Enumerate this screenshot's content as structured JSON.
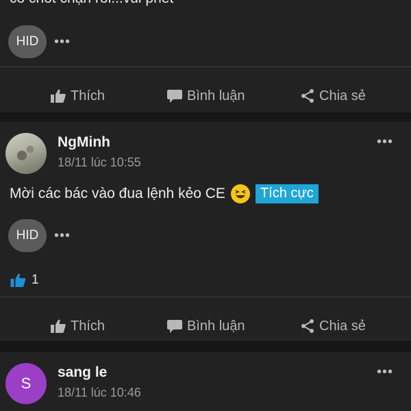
{
  "post1": {
    "cut_text": "có chốt chặn rồi...vui phết",
    "reaction_chip": "HID",
    "more": "•••"
  },
  "actions": {
    "like": "Thích",
    "comment": "Bình luận",
    "share": "Chia sẻ"
  },
  "post2": {
    "username": "NgMinh",
    "time": "18/11 lúc 10:55",
    "text": "Mời các bác vào đua lệnh kẻo CE",
    "emoji": "laughing-emoji",
    "badge": "Tích cực",
    "reaction_chip": "HID",
    "more": "•••",
    "like_count": "1"
  },
  "post3": {
    "avatar_letter": "S",
    "username": "sang le",
    "time": "18/11 lúc 10:46",
    "more": "•••"
  },
  "colors": {
    "background": "#161616",
    "card": "#222222",
    "badge": "#1fa6d8",
    "like_blue": "#1f8fd6",
    "avatar_purple": "#9b3fc7"
  }
}
